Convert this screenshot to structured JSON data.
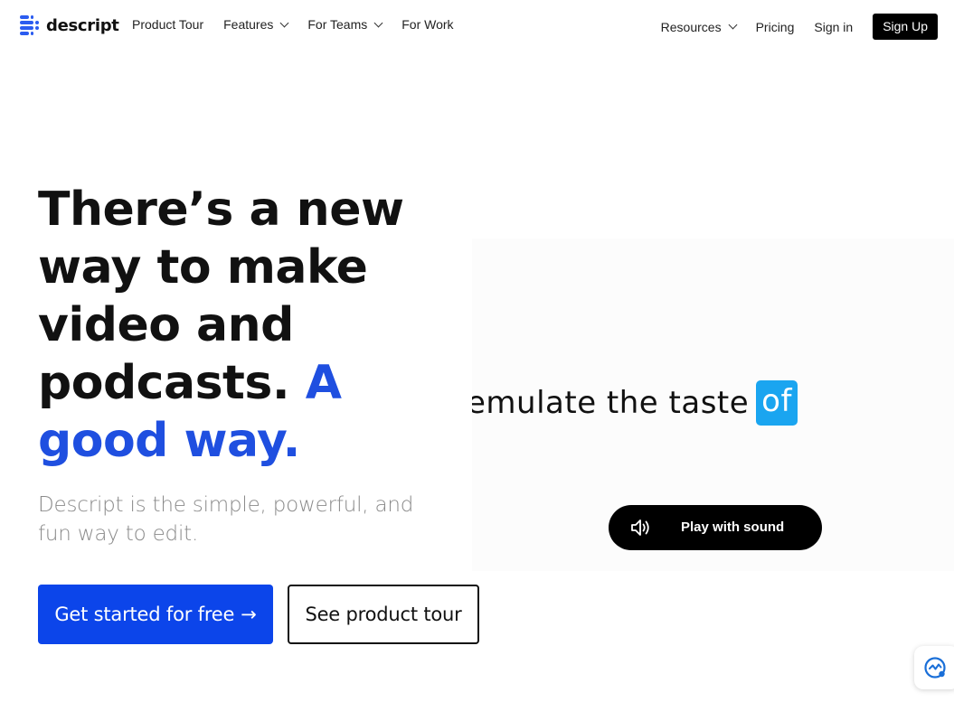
{
  "brand": {
    "name": "descript"
  },
  "nav": {
    "left": [
      {
        "label": "Product Tour",
        "dropdown": false
      },
      {
        "label": "Features",
        "dropdown": true
      },
      {
        "label": "For Teams",
        "dropdown": true
      },
      {
        "label": "For Work",
        "dropdown": false
      }
    ],
    "right": [
      {
        "label": "Resources",
        "dropdown": true
      },
      {
        "label": "Pricing",
        "dropdown": false
      },
      {
        "label": "Sign in",
        "dropdown": false
      }
    ],
    "signup_label": "Sign Up"
  },
  "hero": {
    "headline_line1": "There’s a new",
    "headline_line2": "way to make",
    "headline_line3": "video and",
    "headline_line4_plain": "podcasts.",
    "headline_line4_accent": "A",
    "headline_line5_accent": "good way.",
    "subhead": "Descript is the simple, powerful, and fun way to edit.",
    "primary_cta": "Get started for free",
    "primary_cta_arrow": "→",
    "secondary_cta": "See product tour"
  },
  "video": {
    "caption_text": "emulate the taste",
    "caption_highlight": "of",
    "play_label": "Play with sound"
  },
  "colors": {
    "accent_blue": "#1f4fe0",
    "cta_blue": "#0c45ea",
    "caption_highlight": "#1aa5f0",
    "brand_mark": "#2b5cf0"
  },
  "icons": {
    "logo": "descript-logo-icon",
    "speaker": "speaker-icon",
    "widget": "chat-widget-icon"
  }
}
